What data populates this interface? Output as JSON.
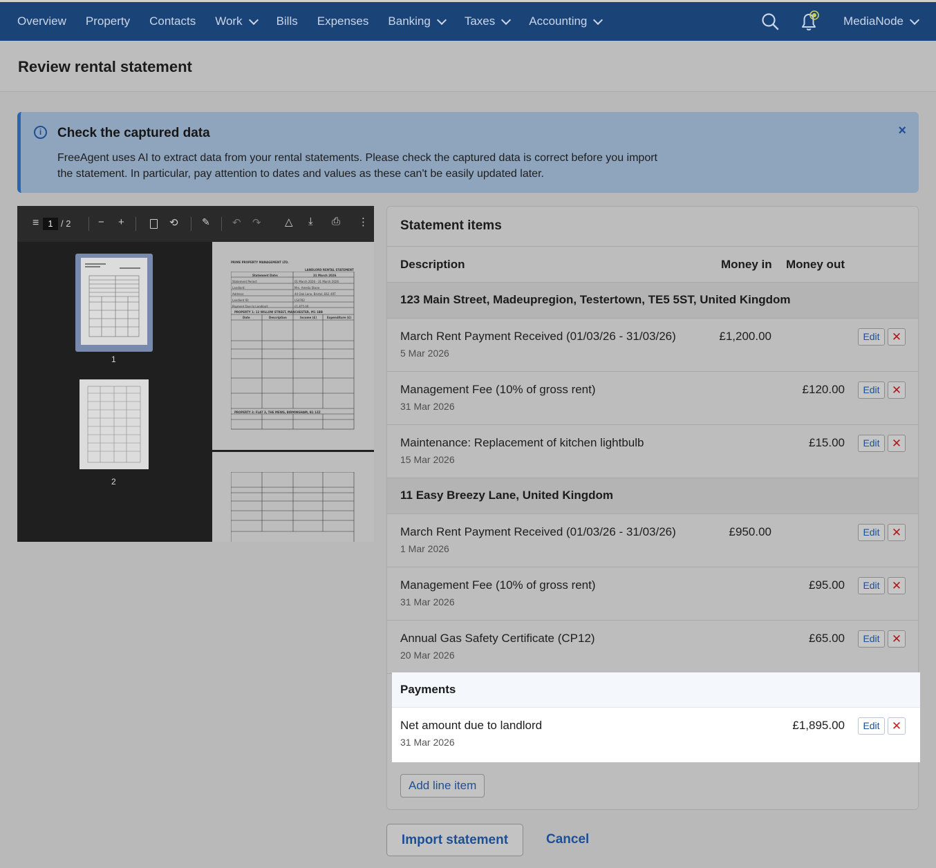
{
  "nav": {
    "items": [
      {
        "label": "Overview",
        "dropdown": false
      },
      {
        "label": "Property",
        "dropdown": false
      },
      {
        "label": "Contacts",
        "dropdown": false
      },
      {
        "label": "Work",
        "dropdown": true
      },
      {
        "label": "Bills",
        "dropdown": false
      },
      {
        "label": "Expenses",
        "dropdown": false
      },
      {
        "label": "Banking",
        "dropdown": true
      },
      {
        "label": "Taxes",
        "dropdown": true
      },
      {
        "label": "Accounting",
        "dropdown": true
      }
    ],
    "account_label": "MediaNode",
    "icons": {
      "search": "search-icon",
      "notifications": "bell-icon"
    }
  },
  "page": {
    "title": "Review rental statement"
  },
  "banner": {
    "title": "Check the captured data",
    "text": "FreeAgent uses AI to extract data from your rental statements. Please check the captured data is correct before you import the statement. In particular, pay attention to dates and values as these can't be easily updated later.",
    "close_label": "×"
  },
  "pdf": {
    "current_page": "1",
    "total_pages": "/ 2",
    "thumb_labels": [
      "1",
      "2"
    ],
    "doc": {
      "company": "PRIME PROPERTY MANAGEMENT LTD.",
      "heading": "LANDLORD RENTAL STATEMENT",
      "fields": [
        {
          "label": "Statement Date:",
          "value": "31 March 2026"
        },
        {
          "label": "Statement Period:",
          "value": "01 March 2026 - 31 March 2026"
        },
        {
          "label": "Landlord:",
          "value": "Mrs. Amelia Stone"
        },
        {
          "label": "Address:",
          "value": "44 Oak Lane, Bristol, BS1 4RT"
        },
        {
          "label": "Landlord ID:",
          "value": "LS4782"
        },
        {
          "label": "Payment Due to Landlord:",
          "value": "£1,875.00"
        }
      ],
      "property1": "PROPERTY 1: 12 WILLOW STREET, MANCHESTER, M1 1BB",
      "property2": "PROPERTY 2: FLAT 3, THE MEWS, BIRMINGHAM, B1 1ZZ",
      "columns": [
        "Date",
        "Description",
        "Income (£)",
        "Expenditure (£)"
      ]
    }
  },
  "statement": {
    "title": "Statement items",
    "headers": {
      "description": "Description",
      "money_in": "Money in",
      "money_out": "Money out"
    },
    "groups": [
      {
        "label": "123 Main Street, Madeupregion, Testertown, TE5 5ST, United Kingdom",
        "items": [
          {
            "description": "March Rent Payment Received (01/03/26 - 31/03/26)",
            "date": "5 Mar 2026",
            "money_in": "£1,200.00",
            "money_out": ""
          },
          {
            "description": "Management Fee (10% of gross rent)",
            "date": "31 Mar 2026",
            "money_in": "",
            "money_out": "£120.00"
          },
          {
            "description": "Maintenance: Replacement of kitchen lightbulb",
            "date": "15 Mar 2026",
            "money_in": "",
            "money_out": "£15.00"
          }
        ]
      },
      {
        "label": "11 Easy Breezy Lane, United Kingdom",
        "items": [
          {
            "description": "March Rent Payment Received (01/03/26 - 31/03/26)",
            "date": "1 Mar 2026",
            "money_in": "£950.00",
            "money_out": ""
          },
          {
            "description": "Management Fee (10% of gross rent)",
            "date": "31 Mar 2026",
            "money_in": "",
            "money_out": "£95.00"
          },
          {
            "description": "Annual Gas Safety Certificate (CP12)",
            "date": "20 Mar 2026",
            "money_in": "",
            "money_out": "£65.00"
          }
        ]
      }
    ],
    "payments": {
      "label": "Payments",
      "item": {
        "description": "Net amount due to landlord",
        "date": "31 Mar 2026",
        "money_out": "£1,895.00"
      }
    },
    "edit_label": "Edit",
    "delete_label": "✕",
    "add_line_label": "Add line item"
  },
  "actions": {
    "import_label": "Import statement",
    "cancel_label": "Cancel"
  },
  "colors": {
    "nav_bg": "#1a4377",
    "link": "#1c4f96",
    "delete": "#c81e1e",
    "banner_accent": "#2a65b0"
  }
}
